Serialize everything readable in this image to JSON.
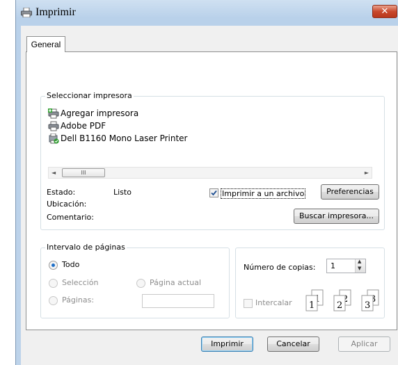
{
  "window": {
    "title": "Imprimir",
    "close_label": "✕"
  },
  "tabs": [
    {
      "label": "General"
    }
  ],
  "select_printer": {
    "legend": "Seleccionar impresora",
    "printers": [
      {
        "label": "Agregar impresora",
        "icon": "add-printer-icon"
      },
      {
        "label": "Adobe PDF",
        "icon": "printer-icon"
      },
      {
        "label": "Dell B1160 Mono Laser Printer",
        "icon": "printer-default-icon"
      }
    ],
    "scroll_thumb_label": "III",
    "status_label": "Estado:",
    "status_value": "Listo",
    "location_label": "Ubicación:",
    "comment_label": "Comentario:",
    "print_to_file": {
      "label": "Imprimir a un archivo",
      "checked": true
    },
    "preferences_button": "Preferencias",
    "find_printer_button": "Buscar impresora..."
  },
  "page_range": {
    "legend": "Intervalo de páginas",
    "all": "Todo",
    "selection": "Selección",
    "current_page": "Página actual",
    "pages": "Páginas:",
    "pages_value": ""
  },
  "copies": {
    "label": "Número de copias:",
    "value": "1",
    "collate": "Intercalar"
  },
  "footer": {
    "print_button": "Imprimir",
    "cancel_button": "Cancelar",
    "apply_button": "Aplicar"
  }
}
